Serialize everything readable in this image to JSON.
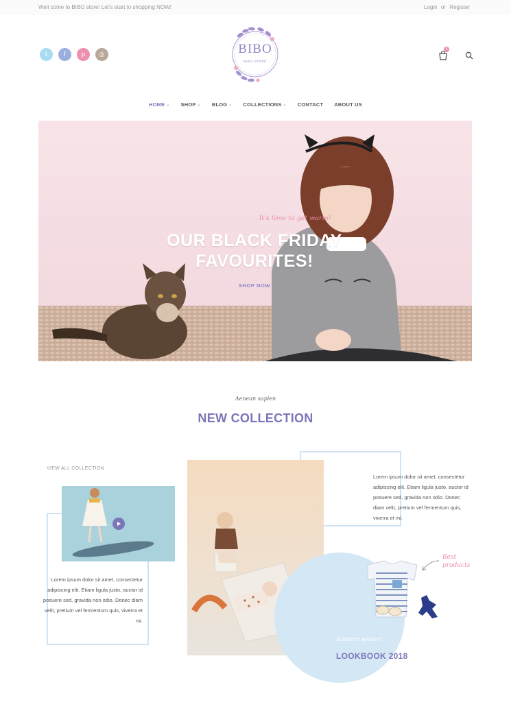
{
  "topbar": {
    "welcome": "Well come to BIBO store! Let's start to shopping NOW!",
    "login": "Login",
    "or": "or",
    "register": "Register"
  },
  "social": [
    {
      "name": "twitter",
      "glyph": "t",
      "color": "#a9dcf2"
    },
    {
      "name": "facebook",
      "glyph": "f",
      "color": "#9aaee0"
    },
    {
      "name": "pinterest",
      "glyph": "p",
      "color": "#ec8fb0"
    },
    {
      "name": "instagram",
      "glyph": "◎",
      "color": "#b8a89a"
    }
  ],
  "logo": {
    "title": "BIBO",
    "subtitle": "BABY STORE"
  },
  "cart": {
    "count": "0"
  },
  "nav": [
    {
      "label": "HOME",
      "dropdown": true
    },
    {
      "label": "SHOP",
      "dropdown": true
    },
    {
      "label": "BLOG",
      "dropdown": true
    },
    {
      "label": "COLLECTIONS",
      "dropdown": true
    },
    {
      "label": "CONTACT",
      "dropdown": false
    },
    {
      "label": "ABOUT US",
      "dropdown": false
    }
  ],
  "hero": {
    "tagline": "It's time to get warm!",
    "title_line1": "OUR BLACK FRIDAY",
    "title_line2": "FAVOURITES!",
    "button": "SHOP NOW"
  },
  "collection": {
    "script": "Aenean sapien",
    "title": "NEW COLLECTION",
    "view_all": "VIEW ALL COLLECTION",
    "text_left": "Lorem ipsum dolor sit amet, consectetur adipiscing elit. Etiam ligula justo, auctor id posuere sed, gravida non odio. Donec diam velit, pretium vel fermentum quis, viverra et mi.",
    "text_right": "Lorem ipsum dolor sit amet, consectetur adipiscing elit. Etiam ligula justo, auctor id posuere sed, gravida non odio. Donec diam velit, pretium vel fermentum quis, viverra et mi.",
    "best_line1": "Best",
    "best_line2": "products",
    "lookbook_script": "Autumn winter!",
    "lookbook_title": "LOOKBOOK 2018"
  },
  "colors": {
    "accent": "#7a76b9",
    "pink": "#e88fb0",
    "light_blue": "#cfe3f4"
  }
}
